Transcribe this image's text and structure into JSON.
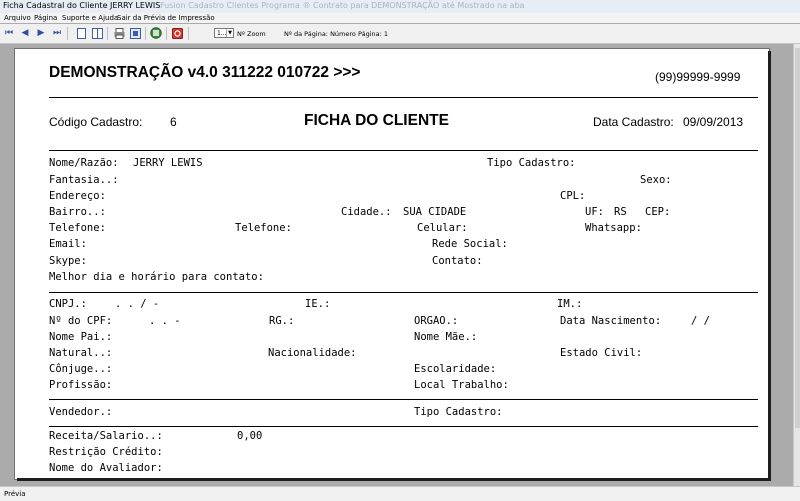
{
  "window": {
    "title": "Ficha Cadastral do Cliente JERRY LEWIS",
    "ghost_title": "Fusion Cadastro Clientes Programa ® Contrato para DEMONSTRAÇÃO até Mostrado na aba"
  },
  "menu": {
    "items": [
      "Arquivo",
      "Página",
      "Suporte e Ajuda",
      "Sair da Prévia de Impressão"
    ]
  },
  "toolbar": {
    "zoom_value": "1...",
    "zoom_label": "Nº Zoom",
    "page_info": "Nº da Página: Número Página: 1"
  },
  "report": {
    "header_title": "DEMONSTRAÇÃO v4.0 311222 010722 >>>",
    "phone": "(99)99999-9999",
    "codigo_label": "Código Cadastro:",
    "codigo_value": "6",
    "form_title": "FICHA DO CLIENTE",
    "data_cadastro_label": "Data Cadastro:",
    "data_cadastro_value": "09/09/2013",
    "nome_label": "Nome/Razão:",
    "nome_value": "JERRY LEWIS",
    "tipo_cadastro_label": "Tipo Cadastro:",
    "fantasia_label": "Fantasia..:",
    "sexo_label": "Sexo:",
    "endereco_label": "Endereço:",
    "cpl_label": "CPL:",
    "bairro_label": "Bairro..:",
    "cidade_label": "Cidade.:",
    "cidade_value": "SUA CIDADE",
    "uf_label": "UF:",
    "uf_value": "RS",
    "cep_label": "CEP:",
    "telefone1_label": "Telefone:",
    "telefone2_label": "Telefone:",
    "celular_label": "Celular:",
    "whatsapp_label": "Whatsapp:",
    "email_label": "Email:",
    "rede_social_label": "Rede Social:",
    "skype_label": "Skype:",
    "contato_label": "Contato:",
    "melhor_dia_label": "Melhor dia e horário para contato:",
    "cnpj_label": "CNPJ.:",
    "cnpj_mask": ".   .   /   -",
    "ie_label": "IE.:",
    "im_label": "IM.:",
    "cpf_label": "Nº do CPF:",
    "cpf_mask": ".   .   -",
    "rg_label": "RG.:",
    "orgao_label": "ORGAO.:",
    "data_nasc_label": "Data Nascimento:",
    "data_nasc_mask": "/  /",
    "nome_pai_label": "Nome Pai.:",
    "nome_mae_label": "Nome Mãe.:",
    "natural_label": "Natural..:",
    "nacionalidade_label": "Nacionalidade:",
    "estado_civil_label": "Estado Civil:",
    "conjuge_label": "Cônjuge..:",
    "escolaridade_label": "Escolaridade:",
    "profissao_label": "Profissão:",
    "local_trabalho_label": "Local Trabalho:",
    "vendedor_label": "Vendedor.:",
    "tipo_cadastro2_label": "Tipo Cadastro:",
    "receita_label": "Receita/Salario..:",
    "receita_value": "0,00",
    "restricao_label": "Restrição Crédito:",
    "avaliador_label": "Nome do Avaliador:"
  },
  "status": {
    "text": "Prévia"
  }
}
